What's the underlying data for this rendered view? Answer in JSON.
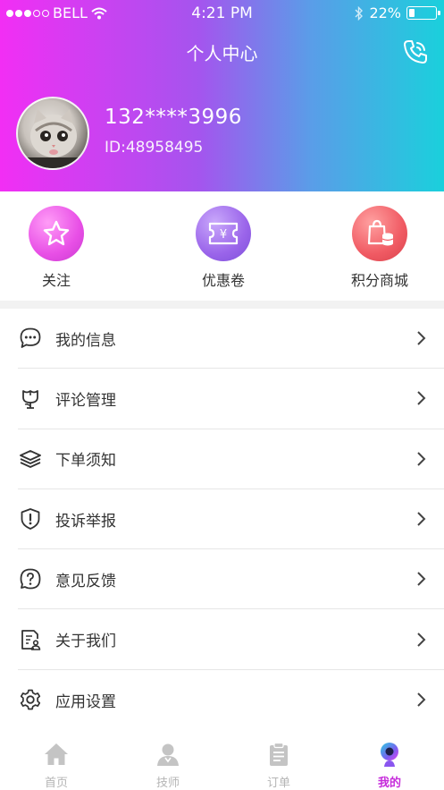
{
  "status_bar": {
    "carrier": "BELL",
    "time": "4:21 PM",
    "battery_percent": "22%",
    "battery_level": 0.22,
    "signal_bars_filled": 3,
    "signal_bars_total": 5
  },
  "header": {
    "title": "个人中心",
    "phone_icon": "phone-icon",
    "gradient_colors": [
      "#f22ef4",
      "#a455ee",
      "#5a9de8",
      "#1ad0dc"
    ]
  },
  "profile": {
    "phone": "132****3996",
    "id_text": "ID:48958495"
  },
  "quick_actions": [
    {
      "label": "关注",
      "icon": "star-icon",
      "color": "#e84fe6"
    },
    {
      "label": "优惠卷",
      "icon": "coupon-icon",
      "color": "#9a64ea"
    },
    {
      "label": "积分商城",
      "icon": "points-mall-icon",
      "color": "#f05a63"
    }
  ],
  "menu": [
    {
      "label": "我的信息",
      "icon": "chat-bubble-icon"
    },
    {
      "label": "评论管理",
      "icon": "flower-icon"
    },
    {
      "label": "下单须知",
      "icon": "layers-icon"
    },
    {
      "label": "投诉举报",
      "icon": "shield-alert-icon"
    },
    {
      "label": "意见反馈",
      "icon": "question-circle-icon"
    },
    {
      "label": "关于我们",
      "icon": "document-person-icon"
    },
    {
      "label": "应用设置",
      "icon": "gear-icon"
    }
  ],
  "tabbar": [
    {
      "label": "首页",
      "icon": "home-icon",
      "active": false
    },
    {
      "label": "技师",
      "icon": "technician-icon",
      "active": false
    },
    {
      "label": "订单",
      "icon": "clipboard-icon",
      "active": false
    },
    {
      "label": "我的",
      "icon": "profile-icon",
      "active": true
    }
  ],
  "colors": {
    "accent": "#c62ddb",
    "tab_inactive": "#b5b5b5",
    "divider": "#e6e6e6"
  }
}
